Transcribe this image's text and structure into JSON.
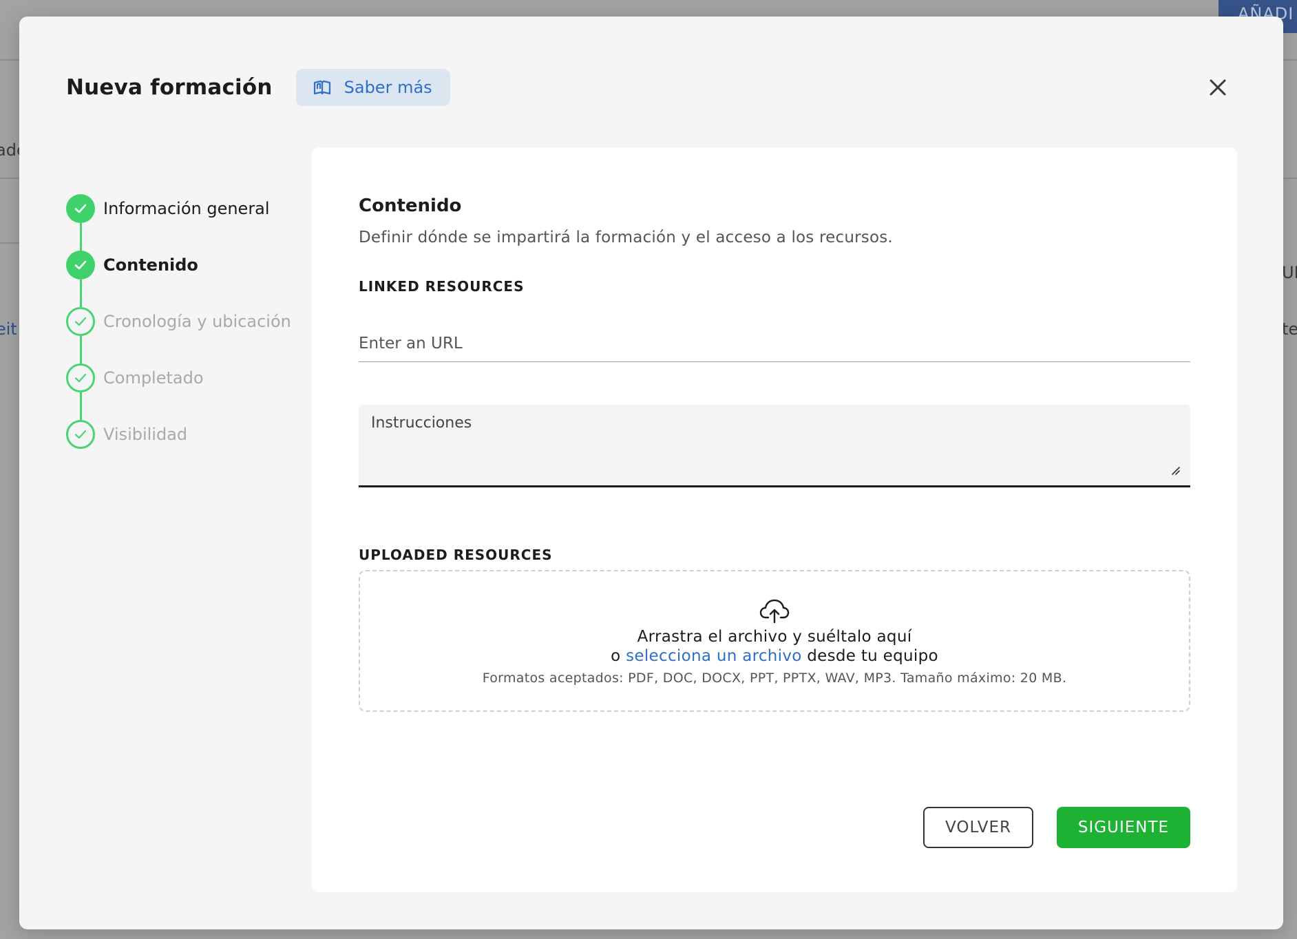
{
  "background": {
    "add_button_label": "AÑADI",
    "fragments": [
      "adc",
      "eit",
      "UI",
      "te"
    ]
  },
  "modal": {
    "title": "Nueva formación",
    "learn_more_label": "Saber más",
    "close_icon": "close-icon"
  },
  "stepper": {
    "steps": [
      {
        "label": "Información general",
        "state": "done"
      },
      {
        "label": "Contenido",
        "state": "current"
      },
      {
        "label": "Cronología y ubicación",
        "state": "pending"
      },
      {
        "label": "Completado",
        "state": "pending"
      },
      {
        "label": "Visibilidad",
        "state": "pending"
      }
    ],
    "color": "#3fd26a"
  },
  "content": {
    "title": "Contenido",
    "description": "Definir dónde se impartirá la formación y el acceso a los recursos.",
    "linked_resources_label": "LINKED RESOURCES",
    "url_placeholder": "Enter an URL",
    "url_value": "",
    "instructions_label": "Instrucciones",
    "uploaded_resources_label": "UPLOADED RESOURCES",
    "dropzone": {
      "line1": "Arrastra el archivo y suéltalo aquí",
      "line2_prefix": "o",
      "line2_link": "selecciona un archivo",
      "line2_suffix": "desde tu equipo",
      "hint": "Formatos aceptados: PDF, DOC, DOCX, PPT, PPTX, WAV, MP3. Tamaño máximo: 20 MB."
    }
  },
  "actions": {
    "back_label": "VOLVER",
    "next_label": "SIGUIENTE"
  },
  "colors": {
    "accent_blue": "#2f6fca",
    "success_green": "#1db233"
  }
}
